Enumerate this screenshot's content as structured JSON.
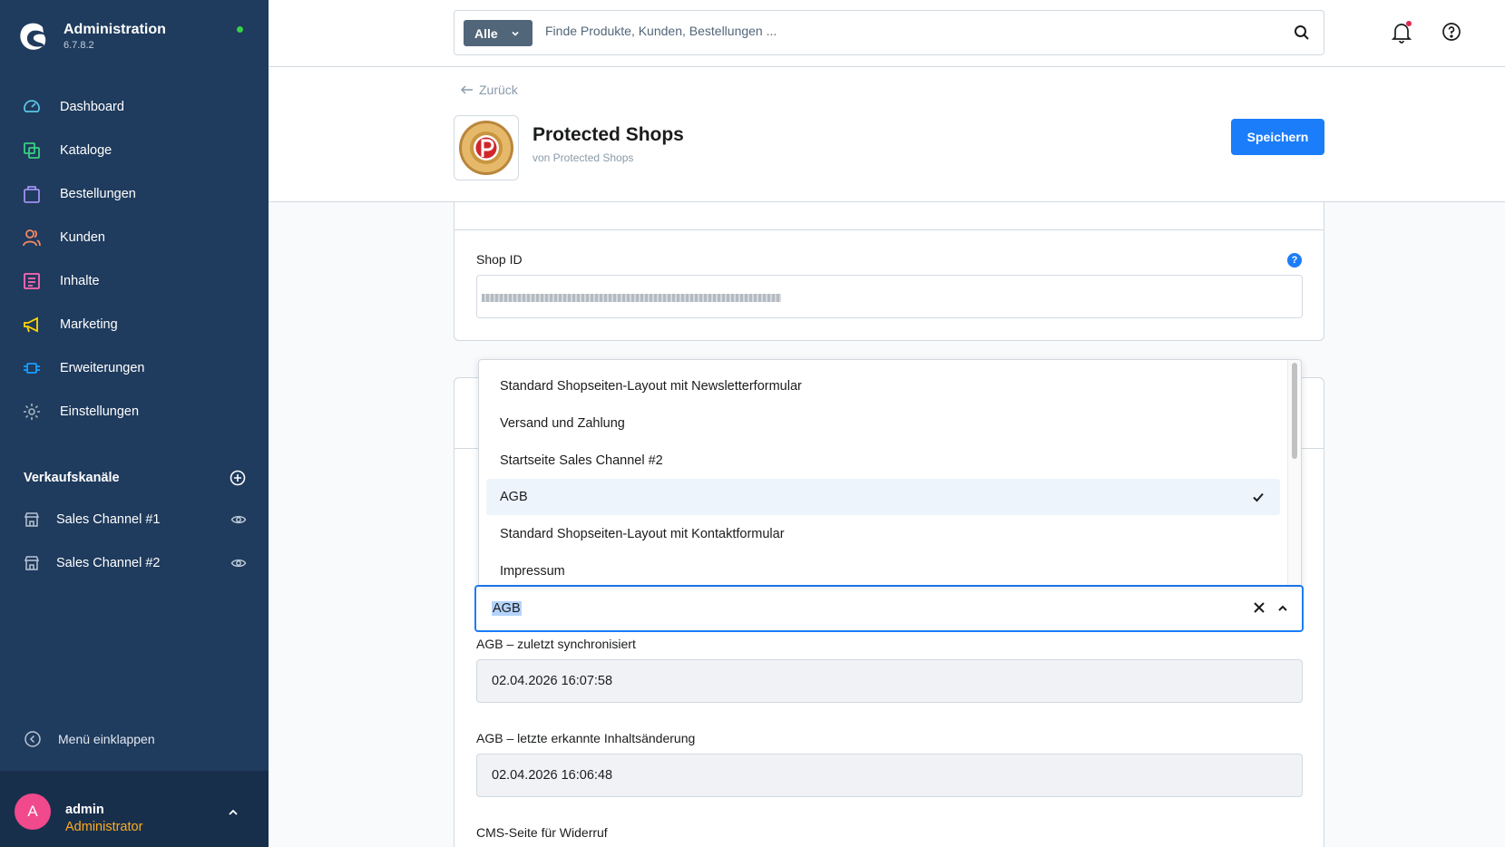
{
  "brand": {
    "title": "Administration",
    "version": "6.7.8.2"
  },
  "nav": [
    {
      "label": "Dashboard",
      "icon": "dashboard-icon"
    },
    {
      "label": "Kataloge",
      "icon": "catalog-icon"
    },
    {
      "label": "Bestellungen",
      "icon": "orders-icon"
    },
    {
      "label": "Kunden",
      "icon": "customers-icon"
    },
    {
      "label": "Inhalte",
      "icon": "content-icon"
    },
    {
      "label": "Marketing",
      "icon": "marketing-icon"
    },
    {
      "label": "Erweiterungen",
      "icon": "extensions-icon"
    },
    {
      "label": "Einstellungen",
      "icon": "settings-icon"
    }
  ],
  "sales_channels": {
    "heading": "Verkaufskanäle",
    "items": [
      {
        "label": "Sales Channel #1"
      },
      {
        "label": "Sales Channel #2"
      }
    ]
  },
  "collapse_label": "Menü einklappen",
  "user": {
    "initial": "A",
    "name": "admin",
    "role": "Administrator"
  },
  "search": {
    "type_label": "Alle",
    "placeholder": "Finde Produkte, Kunden, Bestellungen ..."
  },
  "page": {
    "back_label": "Zurück",
    "plugin_title": "Protected Shops",
    "plugin_author": "von Protected Shops",
    "save_label": "Speichern"
  },
  "shop_id": {
    "label": "Shop ID",
    "help": "?"
  },
  "dropdown": {
    "options": [
      "Standard Shopseiten-Layout mit Newsletterformular",
      "Versand und Zahlung",
      "Startseite Sales Channel #2",
      "AGB",
      "Standard Shopseiten-Layout mit Kontaktformular",
      "Impressum"
    ],
    "selected": "AGB"
  },
  "select": {
    "value": "AGB"
  },
  "fields": {
    "synced_label": "AGB – zuletzt synchronisiert",
    "synced_value": "02.04.2026 16:07:58",
    "changed_label": "AGB – letzte erkannte Inhaltsänderung",
    "changed_value": "02.04.2026 16:06:48",
    "withdrawal_label": "CMS-Seite für Widerruf"
  },
  "colors": {
    "sidebar": "#1f3b5d",
    "accent": "#1b7dfa",
    "online": "#37d046",
    "role": "#ffab20",
    "avatar": "#f0498c"
  }
}
